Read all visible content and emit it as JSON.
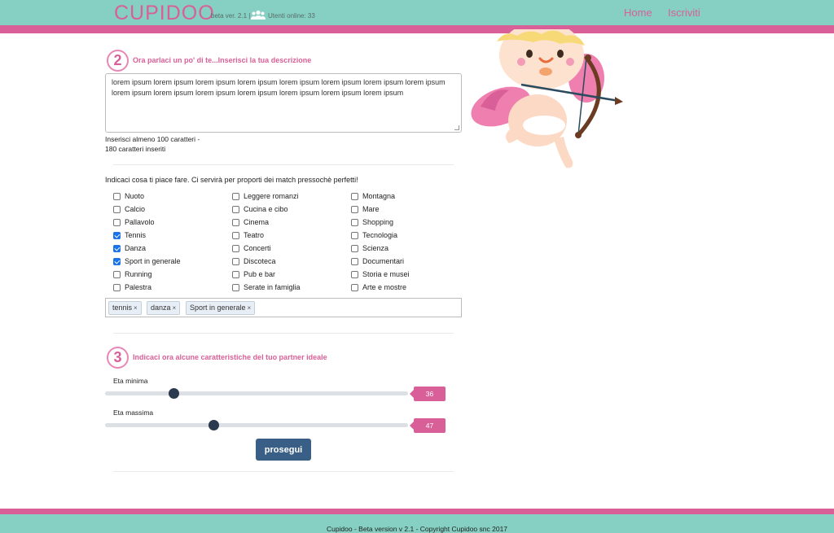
{
  "header": {
    "logo": "CUPIDOO",
    "beta": "beta ver. 2.1 |",
    "online": "Utenti online: 33",
    "nav": [
      "Home",
      "Iscriviti"
    ]
  },
  "step2": {
    "number": "2",
    "title": "Ora parlaci un po' di te...Inserisci la tua descrizione",
    "description": "lorem ipsum lorem ipsum lorem ipsum lorem ipsum lorem ipsum lorem ipsum lorem ipsum lorem ipsum lorem ipsum lorem ipsum lorem ipsum lorem ipsum lorem ipsum lorem ipsum lorem ipsum",
    "hint_min": "Inserisci almeno 100 caratteri -",
    "hint_count": "180 caratteri inseriti"
  },
  "interests": {
    "intro": "Indicaci cosa ti piace fare. Ci servirà per proporti dei match pressochè perfetti!",
    "columns": [
      [
        {
          "label": "Nuoto",
          "checked": false
        },
        {
          "label": "Calcio",
          "checked": false
        },
        {
          "label": "Pallavolo",
          "checked": false
        },
        {
          "label": "Tennis",
          "checked": true
        },
        {
          "label": "Danza",
          "checked": true
        },
        {
          "label": "Sport in generale",
          "checked": true
        },
        {
          "label": "Running",
          "checked": false
        },
        {
          "label": "Palestra",
          "checked": false
        }
      ],
      [
        {
          "label": "Leggere romanzi",
          "checked": false
        },
        {
          "label": "Cucina e cibo",
          "checked": false
        },
        {
          "label": "Cinema",
          "checked": false
        },
        {
          "label": "Teatro",
          "checked": false
        },
        {
          "label": "Concerti",
          "checked": false
        },
        {
          "label": "Discoteca",
          "checked": false
        },
        {
          "label": "Pub e bar",
          "checked": false
        },
        {
          "label": "Serate in famiglia",
          "checked": false
        }
      ],
      [
        {
          "label": "Montagna",
          "checked": false
        },
        {
          "label": "Mare",
          "checked": false
        },
        {
          "label": "Shopping",
          "checked": false
        },
        {
          "label": "Tecnologia",
          "checked": false
        },
        {
          "label": "Scienza",
          "checked": false
        },
        {
          "label": "Documentari",
          "checked": false
        },
        {
          "label": "Storia e musei",
          "checked": false
        },
        {
          "label": "Arte e mostre",
          "checked": false
        }
      ]
    ],
    "tags": [
      "tennis",
      "danza",
      "Sport in generale"
    ],
    "tag_remove": "×"
  },
  "step3": {
    "number": "3",
    "title": "Indicaci ora alcune caratteristiche del tuo partner ideale",
    "min_label": "Eta minima",
    "min_value": "36",
    "max_label": "Eta massima",
    "max_value": "47",
    "submit": "prosegui"
  },
  "footer": {
    "text": "Cupidoo - Beta version v 2.1 - Copyright Cupidoo snc 2017"
  },
  "colors": {
    "teal": "#85d0c3",
    "pink": "#d95f98",
    "button": "#3a5f86",
    "slider_thumb": "#2b3a4e"
  }
}
